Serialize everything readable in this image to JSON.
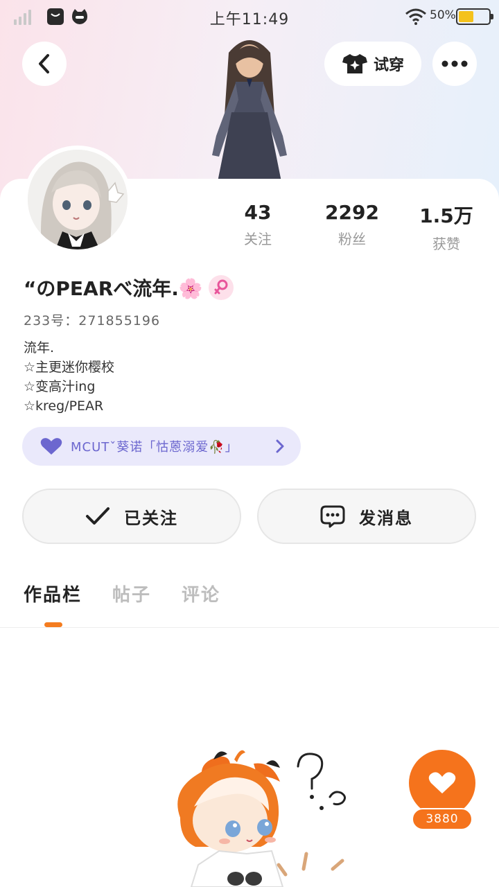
{
  "status_bar": {
    "time": "上午11:49",
    "battery_percent": "50%",
    "battery_level": 0.5
  },
  "header": {
    "try_on_label": "试穿",
    "icons": [
      "back-icon",
      "tshirt-sparkle-icon",
      "more-icon"
    ]
  },
  "profile": {
    "stats": [
      {
        "value": "43",
        "label": "关注"
      },
      {
        "value": "2292",
        "label": "粉丝"
      },
      {
        "value": "1.5万",
        "label": "获赞"
      }
    ],
    "username": "“のPEARべ流年.🌸",
    "uid": "233号：271855196",
    "bio": [
      "流年.",
      "☆主更迷你樱校",
      "☆变高汁ing",
      "☆kreg/PEAR"
    ],
    "club": "MCUTˇ葵诺「怙蒽溺爱🥀」"
  },
  "actions": {
    "followed_label": "已关注",
    "message_label": "发消息"
  },
  "tabs": [
    {
      "label": "作品栏",
      "active": true
    },
    {
      "label": "帖子",
      "active": false
    },
    {
      "label": "评论",
      "active": false
    }
  ],
  "like_button": {
    "count": "3880"
  },
  "colors": {
    "accent": "#f5731c",
    "club_bg": "#eae9fb",
    "club_text": "#6c67cf",
    "gender_badge": "#fde0ea",
    "gender_symbol": "#e8559a"
  }
}
